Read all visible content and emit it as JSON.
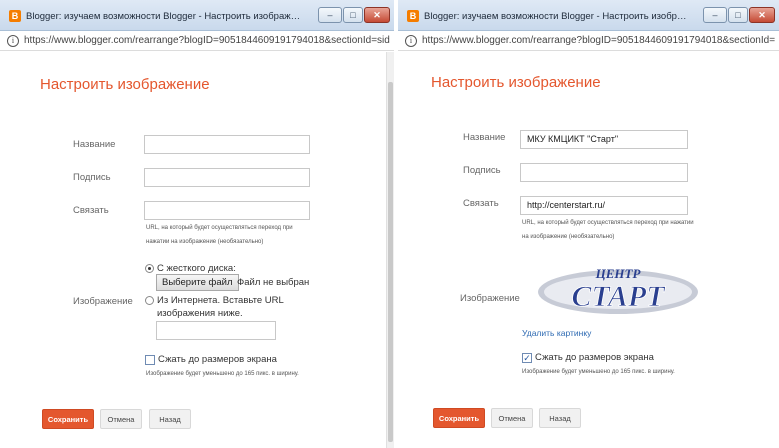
{
  "left": {
    "window_title": "Blogger: изучаем возможности Blogger - Настроить изображение - Google Chr...",
    "url": "https://www.blogger.com/rearrange?blogID=9051844609191794018&sectionId=side...",
    "heading": "Настроить изображение",
    "labels": {
      "name": "Название",
      "caption": "Подпись",
      "link": "Связать",
      "image": "Изображение"
    },
    "values": {
      "name": "",
      "caption": "",
      "link": ""
    },
    "link_hint_1": "URL, на который будет осуществляться переход при",
    "link_hint_2": "нажатии на изображение (необязательно)",
    "radio_disk": "С жесткого диска:",
    "file_button": "Выберите файл",
    "file_status": "Файл не выбран",
    "radio_web_1": "Из Интернета. Вставьте URL",
    "radio_web_2": "изображения ниже.",
    "web_url_value": "",
    "shrink_label": "Сжать до размеров экрана",
    "shrink_checked": false,
    "shrink_hint": "Изображение будет уменьшено до 165 пикс. в ширину.",
    "buttons": {
      "save": "Сохранить",
      "cancel": "Отмена",
      "back": "Назад"
    }
  },
  "right": {
    "window_title": "Blogger: изучаем возможности Blogger - Настроить изображение - Google Chr...",
    "url": "https://www.blogger.com/rearrange?blogID=9051844609191794018&sectionId=side...",
    "heading": "Настроить изображение",
    "labels": {
      "name": "Название",
      "caption": "Подпись",
      "link": "Связать",
      "image": "Изображение"
    },
    "values": {
      "name": "МКУ КМЦИКТ \"Старт\"",
      "caption": "",
      "link": "http://centerstart.ru/"
    },
    "link_hint_1": "URL, на который будет осуществляться переход при нажатии",
    "link_hint_2": "на изображение (необязательно)",
    "logo_text_top": "ЦЕНТР",
    "logo_text_main": "СТАРТ",
    "remove_image": "Удалить картинку",
    "shrink_label": "Сжать до размеров экрана",
    "shrink_checked": true,
    "shrink_hint": "Изображение будет уменьшено до 165 пикс. в ширину.",
    "buttons": {
      "save": "Сохранить",
      "cancel": "Отмена",
      "back": "Назад"
    }
  },
  "window_controls": {
    "minimize": "–",
    "maximize": "□",
    "close": "✕"
  },
  "colors": {
    "accent": "#e4572e",
    "link": "#2f6bb3",
    "logo_blue": "#2a3f8f"
  }
}
